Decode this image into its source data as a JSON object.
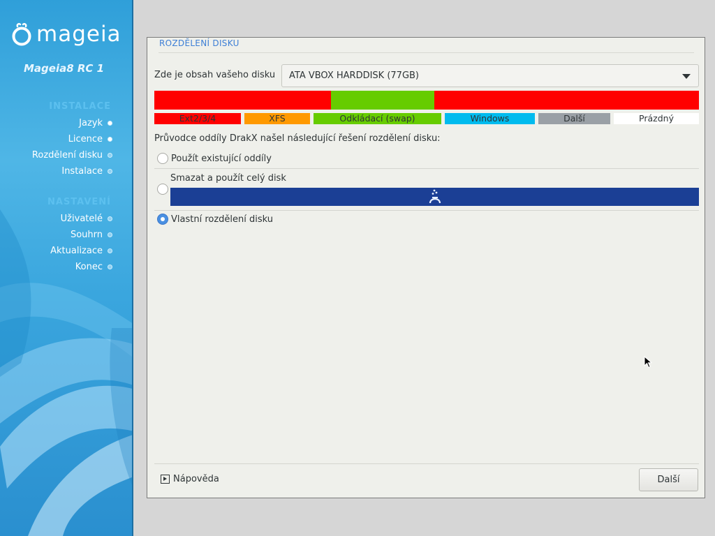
{
  "sidebar": {
    "logo_text": "mageia",
    "release": "Mageia8 RC 1",
    "section_install": "INSTALACE",
    "install_steps": [
      {
        "label": "Jazyk"
      },
      {
        "label": "Licence"
      },
      {
        "label": "Rozdělení disku"
      },
      {
        "label": "Instalace"
      }
    ],
    "section_config": "NASTAVENÍ",
    "config_steps": [
      {
        "label": "Uživatelé"
      },
      {
        "label": "Souhrn"
      },
      {
        "label": "Aktualizace"
      },
      {
        "label": "Konec"
      }
    ]
  },
  "panel": {
    "title": "ROZDĚLENÍ DISKU",
    "disk_label": "Zde je obsah vašeho disku",
    "disk_selected": "ATA VBOX HARDDISK (77GB)",
    "partition_colors": [
      "#ff0000",
      "#66cc00",
      "#ff0000"
    ],
    "legend": [
      {
        "label": "Ext2/3/4",
        "color": "#ff0000"
      },
      {
        "label": "XFS",
        "color": "#ff9900"
      },
      {
        "label": "Odkládací (swap)",
        "color": "#66cc00"
      },
      {
        "label": "Windows",
        "color": "#00bbee"
      },
      {
        "label": "Další",
        "color": "#9aa0a6"
      },
      {
        "label": "Prázdný",
        "color": "#ffffff"
      }
    ],
    "wizard_text": "Průvodce oddíly DrakX našel následující řešení rozdělení disku:",
    "options": {
      "use_existing": "Použít existující oddíly",
      "erase_disk": "Smazat a použít celý disk",
      "custom": "Vlastní rozdělení disku",
      "selected": "custom"
    },
    "help_label": "Nápověda",
    "next_label": "Další"
  }
}
